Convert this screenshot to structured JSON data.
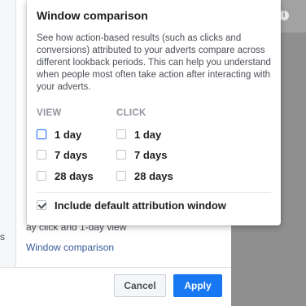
{
  "background": {
    "left_text": "s",
    "covered_text": "ay click and 1-day view",
    "window_comparison_link": "Window comparison"
  },
  "popover": {
    "title": "Window comparison",
    "description": "See how action-based results (such as clicks and conversions) attributed to your adverts compare across different lookback periods. This can help you understand when people most often take action after interacting with your adverts.",
    "view_header": "VIEW",
    "click_header": "CLICK",
    "view_options": [
      {
        "label": "1 day",
        "checked": false
      },
      {
        "label": "7 days",
        "checked": false
      },
      {
        "label": "28 days",
        "checked": false
      }
    ],
    "click_options": [
      {
        "label": "1 day",
        "checked": false
      },
      {
        "label": "7 days",
        "checked": false
      },
      {
        "label": "28 days",
        "checked": false
      }
    ],
    "default_attribution": {
      "label": "Include default attribution window",
      "checked": true
    }
  },
  "footer": {
    "cancel_label": "Cancel",
    "apply_label": "Apply"
  },
  "colors": {
    "accent": "#1877f2",
    "link": "#385898",
    "overlay": "#8f8f8f"
  }
}
